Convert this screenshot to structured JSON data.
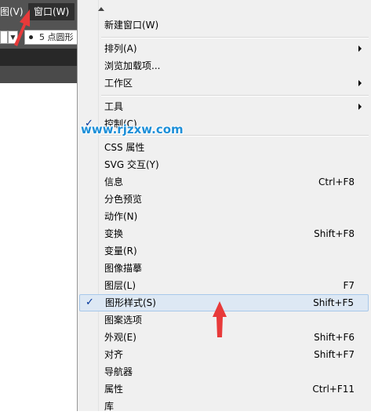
{
  "menubar": {
    "view_label": "图(V)",
    "window_label": "窗口(W)"
  },
  "toolbar": {
    "dropdown_glyph": "▼",
    "brush_label": "5 点圆形"
  },
  "watermark": "www.rjzxw.com",
  "menu": {
    "items": [
      {
        "label": "新建窗口(W)",
        "shortcut": ""
      },
      {
        "label": "排列(A)",
        "shortcut": ""
      },
      {
        "label": "浏览加载项...",
        "shortcut": ""
      },
      {
        "label": "工作区",
        "shortcut": ""
      },
      {
        "label": "工具",
        "shortcut": ""
      },
      {
        "label": "控制(C)",
        "shortcut": ""
      },
      {
        "label": "CSS 属性",
        "shortcut": ""
      },
      {
        "label": "SVG 交互(Y)",
        "shortcut": ""
      },
      {
        "label": "信息",
        "shortcut": "Ctrl+F8"
      },
      {
        "label": "分色预览",
        "shortcut": ""
      },
      {
        "label": "动作(N)",
        "shortcut": ""
      },
      {
        "label": "变换",
        "shortcut": "Shift+F8"
      },
      {
        "label": "变量(R)",
        "shortcut": ""
      },
      {
        "label": "图像描摹",
        "shortcut": ""
      },
      {
        "label": "图层(L)",
        "shortcut": "F7"
      },
      {
        "label": "图形样式(S)",
        "shortcut": "Shift+F5"
      },
      {
        "label": "图案选项",
        "shortcut": ""
      },
      {
        "label": "外观(E)",
        "shortcut": "Shift+F6"
      },
      {
        "label": "对齐",
        "shortcut": "Shift+F7"
      },
      {
        "label": "导航器",
        "shortcut": ""
      },
      {
        "label": "属性",
        "shortcut": "Ctrl+F11"
      },
      {
        "label": "库",
        "shortcut": ""
      }
    ],
    "check_glyph": "✓",
    "highlight_color": "#dde8f4",
    "check_color": "#003399",
    "annotation_arrow_color": "#e83a3a"
  }
}
